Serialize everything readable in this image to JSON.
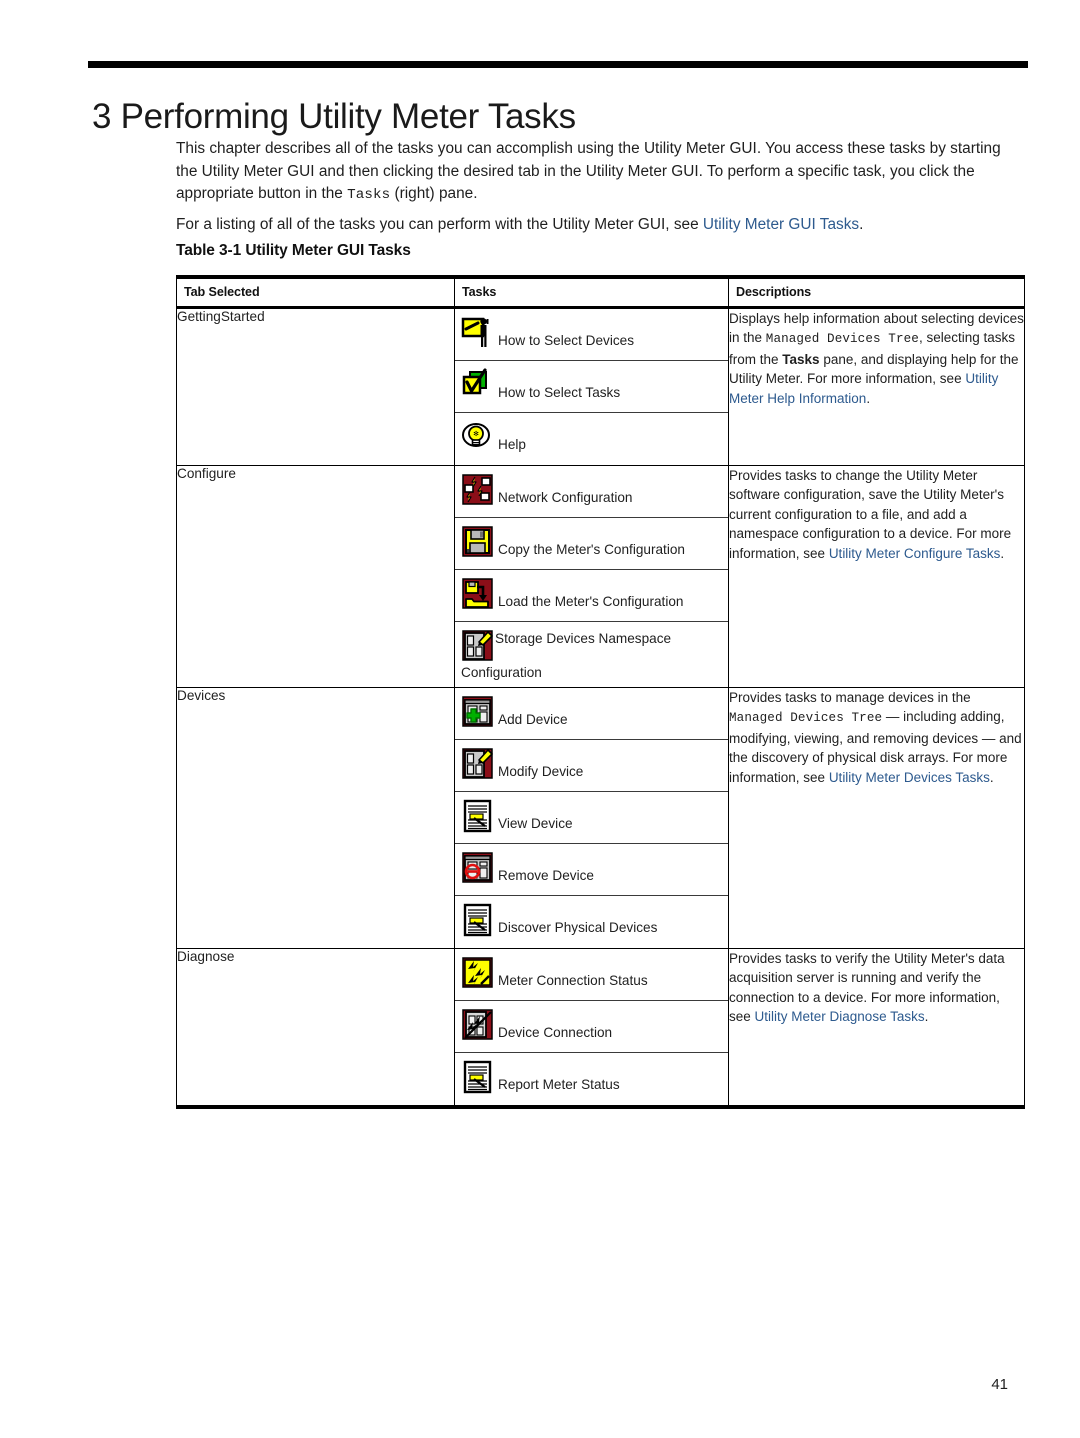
{
  "chapter": {
    "title": "3 Performing Utility Meter Tasks"
  },
  "intro": {
    "p1_part1": "This chapter describes all of the tasks you can accomplish using the Utility Meter GUI. You access these tasks by starting the Utility Meter GUI and then clicking the desired tab in the Utility Meter GUI. To perform a specific task, you click the appropriate button in the ",
    "p1_mono": "Tasks",
    "p1_part2": " (right) pane.",
    "p2_part1": "For a listing of all of the tasks you can perform with the Utility Meter GUI, see ",
    "p2_link": "Utility Meter GUI Tasks",
    "p2_part2": "."
  },
  "table": {
    "caption": "Table 3-1 Utility Meter GUI Tasks",
    "headers": [
      "Tab Selected",
      "Tasks",
      "Descriptions"
    ],
    "rows": [
      {
        "tab": "GettingStarted",
        "tasks": [
          {
            "icon": "select-devices-icon",
            "label": "How to Select Devices"
          },
          {
            "icon": "select-tasks-icon",
            "label": "How to Select Tasks"
          },
          {
            "icon": "help-lightbulb-icon",
            "label": "Help"
          }
        ],
        "description": {
          "s1": "Displays help information about selecting devices in the ",
          "mono1": "Managed Devices Tree",
          "s2": ", selecting tasks from the ",
          "bold1": "Tasks",
          "s3": " pane, and displaying help for the Utility Meter. For more information, see ",
          "link1": "Utility Meter Help Information",
          "s4": "."
        }
      },
      {
        "tab": "Configure",
        "tasks": [
          {
            "icon": "network-configuration-icon",
            "label": "Network Configuration"
          },
          {
            "icon": "floppy-save-icon",
            "label": "Copy the Meter's Configuration"
          },
          {
            "icon": "floppy-load-folder-icon",
            "label": "Load the Meter's Configuration"
          },
          {
            "icon": "storage-namespace-icon",
            "label": "Storage Devices Namespace Configuration"
          }
        ],
        "description": {
          "s1": "Provides tasks to change the Utility Meter software configuration, save the Utility Meter's current configuration to a file, and add a namespace configuration to a device. For more information, see ",
          "link1": "Utility Meter Configure Tasks",
          "s4": "."
        }
      },
      {
        "tab": "Devices",
        "tasks": [
          {
            "icon": "add-device-icon",
            "label": "Add Device"
          },
          {
            "icon": "modify-device-icon",
            "label": "Modify Device"
          },
          {
            "icon": "view-device-icon",
            "label": "View Device"
          },
          {
            "icon": "remove-device-icon",
            "label": "Remove Device"
          },
          {
            "icon": "discover-physical-devices-icon",
            "label": "Discover Physical Devices"
          }
        ],
        "description": {
          "s1": "Provides tasks to manage devices in the ",
          "mono1": "Managed Devices Tree",
          "s2": " — including adding, modifying, viewing, and removing devices — and the discovery of physical disk arrays. For more information, see ",
          "link1": "Utility Meter Devices Tasks",
          "s4": "."
        }
      },
      {
        "tab": "Diagnose",
        "tasks": [
          {
            "icon": "meter-connection-status-icon",
            "label": "Meter Connection Status"
          },
          {
            "icon": "device-connection-icon",
            "label": "Device Connection"
          },
          {
            "icon": "report-meter-status-icon",
            "label": "Report Meter Status"
          }
        ],
        "description": {
          "s1": "Provides tasks to verify the Utility Meter's data acquisition server is running and verify the connection to a device. For more information, see ",
          "link1": "Utility Meter Diagnose Tasks",
          "s4": "."
        }
      }
    ]
  },
  "footer": {
    "page_number": "41"
  },
  "colors": {
    "link": "#2d5a8e",
    "icon_red": "#8b0e18",
    "icon_yellow": "#ffff00",
    "icon_green": "#00a000",
    "text": "#1f1f1f"
  }
}
